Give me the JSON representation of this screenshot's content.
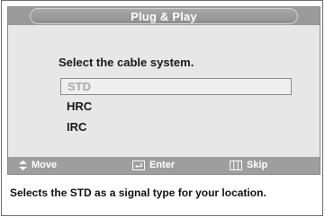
{
  "window": {
    "title": "Plug & Play"
  },
  "dialog": {
    "prompt": "Select the cable system."
  },
  "options": [
    {
      "label": "STD",
      "selected": true
    },
    {
      "label": "HRC",
      "selected": false
    },
    {
      "label": "IRC",
      "selected": false
    }
  ],
  "help_bar": {
    "move_label": "Move",
    "enter_label": "Enter",
    "skip_label": "Skip"
  },
  "footer": {
    "description": "Selects the STD as a signal type for your location."
  },
  "colors": {
    "title_bar": "#9a9a9a",
    "panel_bg": "#e7e7e7",
    "help_bar": "#9e9e9e",
    "selected_text": "#a9a9a9"
  }
}
